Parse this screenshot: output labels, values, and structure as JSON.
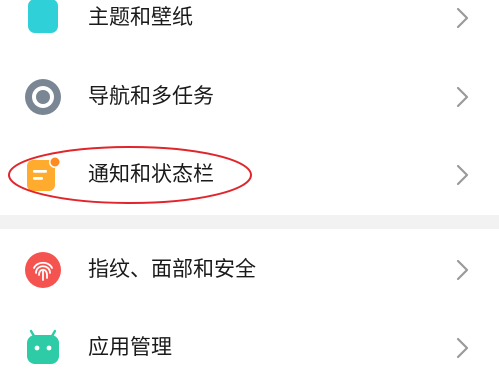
{
  "settings": {
    "items": [
      {
        "label": "主题和壁纸",
        "icon": "theme-shirt-icon",
        "color": "#2fd0d8"
      },
      {
        "label": "导航和多任务",
        "icon": "navigation-circle-icon",
        "color": "#7b8694"
      },
      {
        "label": "通知和状态栏",
        "icon": "notification-icon",
        "color": "#ffab2e"
      },
      {
        "label": "指纹、面部和安全",
        "icon": "fingerprint-icon",
        "color": "#f4534f"
      },
      {
        "label": "应用管理",
        "icon": "android-app-icon",
        "color": "#2dcca6"
      }
    ],
    "chevron": "chevron-right-icon"
  },
  "annotation": {
    "ring_color": "#e0262c",
    "highlighted_item": "通知和状态栏"
  }
}
